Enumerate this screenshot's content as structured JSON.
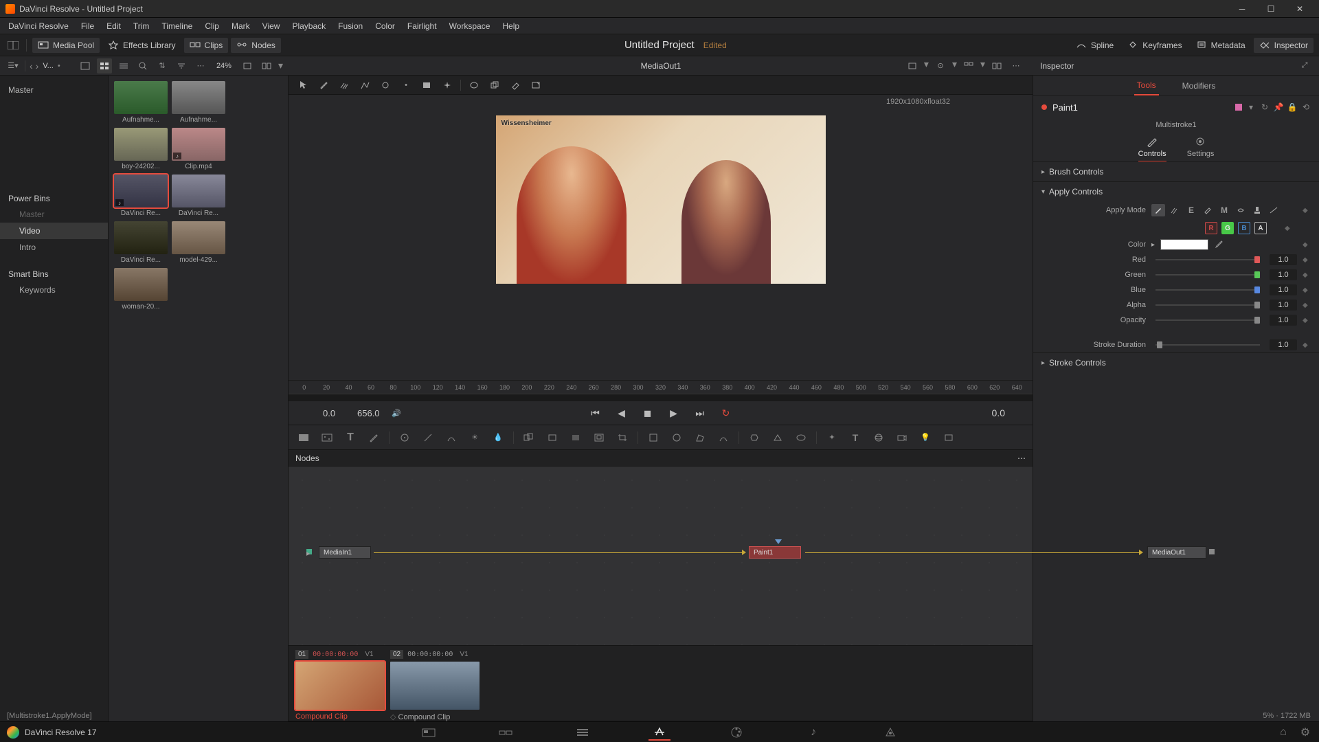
{
  "window": {
    "title": "DaVinci Resolve - Untitled Project"
  },
  "menu": [
    "DaVinci Resolve",
    "File",
    "Edit",
    "Trim",
    "Timeline",
    "Clip",
    "Mark",
    "View",
    "Playback",
    "Fusion",
    "Color",
    "Fairlight",
    "Workspace",
    "Help"
  ],
  "toolbar": {
    "left": [
      {
        "label": "Media Pool",
        "icon": "media-pool-icon"
      },
      {
        "label": "Effects Library",
        "icon": "effects-icon"
      },
      {
        "label": "Clips",
        "icon": "clips-icon"
      },
      {
        "label": "Nodes",
        "icon": "nodes-icon"
      }
    ],
    "project": "Untitled Project",
    "edited": "Edited",
    "right": [
      {
        "label": "Spline",
        "icon": "spline-icon"
      },
      {
        "label": "Keyframes",
        "icon": "keyframes-icon"
      },
      {
        "label": "Metadata",
        "icon": "metadata-icon"
      },
      {
        "label": "Inspector",
        "icon": "inspector-icon"
      }
    ]
  },
  "subbar": {
    "breadcrumb": "V...",
    "zoom": "24%",
    "viewer_name": "MediaOut1",
    "inspector_label": "Inspector"
  },
  "sidebar": {
    "master": "Master",
    "powerbins": "Power Bins",
    "powerbins_items": [
      "Master",
      "Video",
      "Intro"
    ],
    "smartbins": "Smart Bins",
    "smartbins_items": [
      "Keywords"
    ]
  },
  "clips": [
    {
      "name": "Aufnahme..."
    },
    {
      "name": "Aufnahme..."
    },
    {
      "name": "boy-24202..."
    },
    {
      "name": "Clip.mp4"
    },
    {
      "name": "DaVinci Re..."
    },
    {
      "name": "DaVinci Re..."
    },
    {
      "name": "DaVinci Re..."
    },
    {
      "name": "model-429..."
    },
    {
      "name": "woman-20..."
    }
  ],
  "viewer": {
    "info": "1920x1080xfloat32",
    "overlay_label": "Wissensheimer",
    "time_start": "0.0",
    "time_end": "656.0",
    "time_current": "0.0",
    "ruler": [
      "0",
      "20",
      "40",
      "60",
      "80",
      "100",
      "120",
      "140",
      "160",
      "180",
      "200",
      "220",
      "240",
      "260",
      "280",
      "300",
      "320",
      "340",
      "360",
      "380",
      "400",
      "420",
      "440",
      "460",
      "480",
      "500",
      "520",
      "540",
      "560",
      "580",
      "600",
      "620",
      "640"
    ]
  },
  "nodes_panel": {
    "title": "Nodes",
    "nodes": [
      {
        "name": "MediaIn1"
      },
      {
        "name": "Paint1"
      },
      {
        "name": "MediaOut1"
      }
    ]
  },
  "clip_strip": [
    {
      "num": "01",
      "tc": "00:00:00:00",
      "track": "V1",
      "name": "Compound Clip",
      "active": true
    },
    {
      "num": "02",
      "tc": "00:00:00:00",
      "track": "V1",
      "name": "Compound Clip",
      "active": false
    }
  ],
  "status": {
    "line": "[Multistroke1.ApplyMode]",
    "mem": "5% · 1722 MB"
  },
  "inspector": {
    "tabs": [
      "Tools",
      "Modifiers"
    ],
    "node": "Paint1",
    "stroke_label": "Multistroke1",
    "subtabs": [
      "Controls",
      "Settings"
    ],
    "sections": {
      "brush": "Brush Controls",
      "apply": "Apply Controls",
      "stroke": "Stroke Controls"
    },
    "apply_mode_label": "Apply Mode",
    "channels": [
      "R",
      "G",
      "B",
      "A"
    ],
    "color_label": "Color",
    "params": [
      {
        "label": "Red",
        "value": "1.0"
      },
      {
        "label": "Green",
        "value": "1.0"
      },
      {
        "label": "Blue",
        "value": "1.0"
      },
      {
        "label": "Alpha",
        "value": "1.0"
      },
      {
        "label": "Opacity",
        "value": "1.0"
      }
    ],
    "stroke_duration": {
      "label": "Stroke Duration",
      "value": "1.0"
    }
  },
  "bottom": {
    "app": "DaVinci Resolve 17"
  }
}
